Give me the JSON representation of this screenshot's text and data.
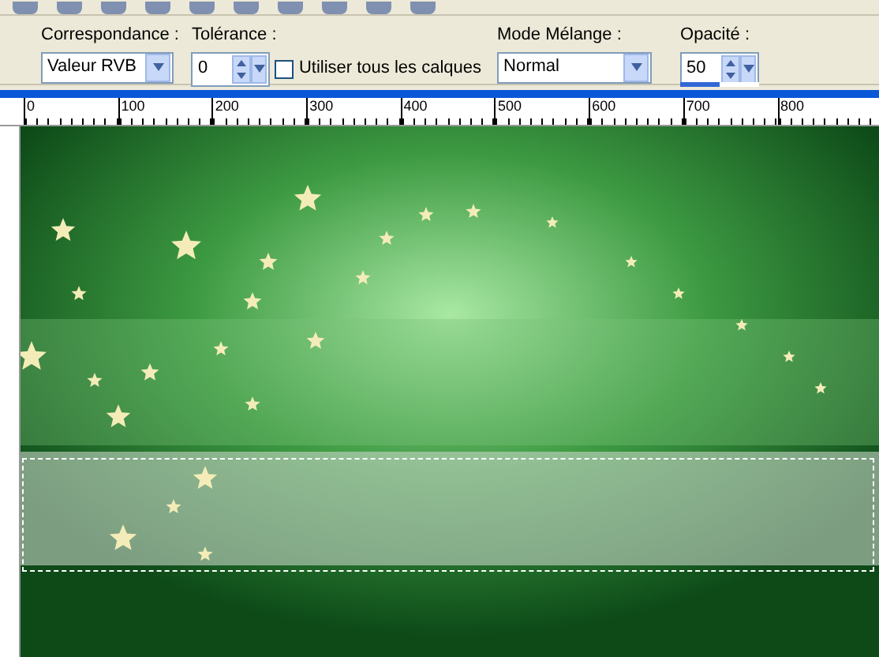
{
  "options_bar": {
    "match_mode": {
      "label": "Correspondance :",
      "value": "Valeur RVB"
    },
    "tolerance": {
      "label": "Tolérance :",
      "value": "0"
    },
    "all_layers": {
      "label": "Utiliser tous les calques",
      "checked": false
    },
    "blend_mode": {
      "label": "Mode Mélange :",
      "value": "Normal"
    },
    "opacity": {
      "label": "Opacité :",
      "value": "50",
      "level": 0.5
    }
  },
  "ruler": {
    "ticks": [
      "0",
      "100",
      "200",
      "300",
      "400",
      "500",
      "600",
      "700",
      "800"
    ]
  }
}
